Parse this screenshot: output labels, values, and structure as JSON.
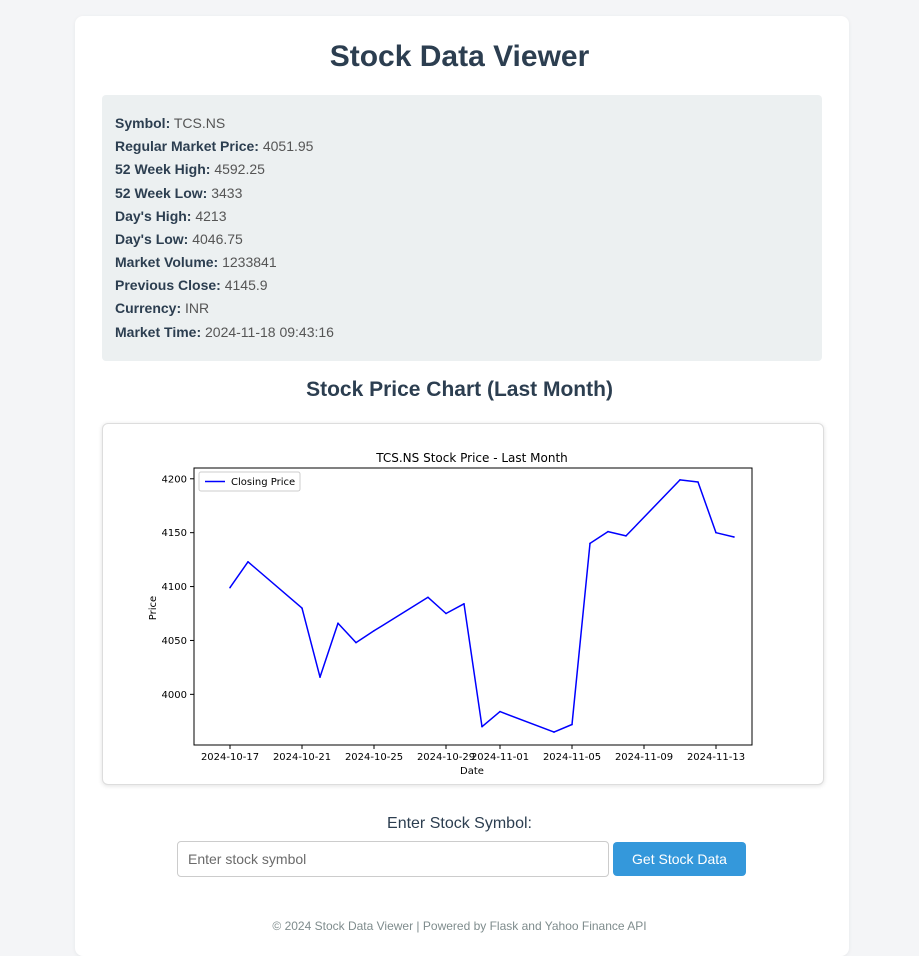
{
  "app": {
    "title": "Stock Data Viewer"
  },
  "info": [
    {
      "label": "Symbol:",
      "value": "TCS.NS"
    },
    {
      "label": "Regular Market Price:",
      "value": "4051.95"
    },
    {
      "label": "52 Week High:",
      "value": "4592.25"
    },
    {
      "label": "52 Week Low:",
      "value": "3433"
    },
    {
      "label": "Day's High:",
      "value": "4213"
    },
    {
      "label": "Day's Low:",
      "value": "4046.75"
    },
    {
      "label": "Market Volume:",
      "value": "1233841"
    },
    {
      "label": "Previous Close:",
      "value": "4145.9"
    },
    {
      "label": "Currency:",
      "value": "INR"
    },
    {
      "label": "Market Time:",
      "value": "2024-11-18 09:43:16"
    }
  ],
  "chart_section": {
    "heading": "Stock Price Chart (Last Month)"
  },
  "chart_data": {
    "type": "line",
    "title": "TCS.NS Stock Price - Last Month",
    "xlabel": "Date",
    "ylabel": "Price",
    "legend": "top-left",
    "grid": false,
    "x_ticks": [
      "2024-10-17",
      "2024-10-21",
      "2024-10-25",
      "2024-10-29",
      "2024-11-01",
      "2024-11-05",
      "2024-11-09",
      "2024-11-13"
    ],
    "y_ticks": [
      4000,
      4050,
      4100,
      4150,
      4200
    ],
    "xlim": [
      "2024-10-15",
      "2024-11-15"
    ],
    "ylim": [
      3953,
      4210
    ],
    "series": [
      {
        "name": "Closing Price",
        "color": "#0000ff",
        "x": [
          "2024-10-17",
          "2024-10-18",
          "2024-10-21",
          "2024-10-22",
          "2024-10-23",
          "2024-10-24",
          "2024-10-25",
          "2024-10-28",
          "2024-10-29",
          "2024-10-30",
          "2024-10-31",
          "2024-11-01",
          "2024-11-04",
          "2024-11-05",
          "2024-11-06",
          "2024-11-07",
          "2024-11-08",
          "2024-11-11",
          "2024-11-12",
          "2024-11-13",
          "2024-11-14"
        ],
        "y": [
          4099,
          4123,
          4080,
          4016,
          4066,
          4048,
          4059,
          4090,
          4075,
          4084,
          3970,
          3984,
          3965,
          3972,
          4140,
          4151,
          4147,
          4199,
          4197,
          4150,
          4146
        ]
      }
    ]
  },
  "form": {
    "label": "Enter Stock Symbol:",
    "placeholder": "Enter stock symbol",
    "value": "",
    "button_label": "Get Stock Data"
  },
  "footer": {
    "text": "© 2024 Stock Data Viewer | Powered by Flask and Yahoo Finance API"
  }
}
